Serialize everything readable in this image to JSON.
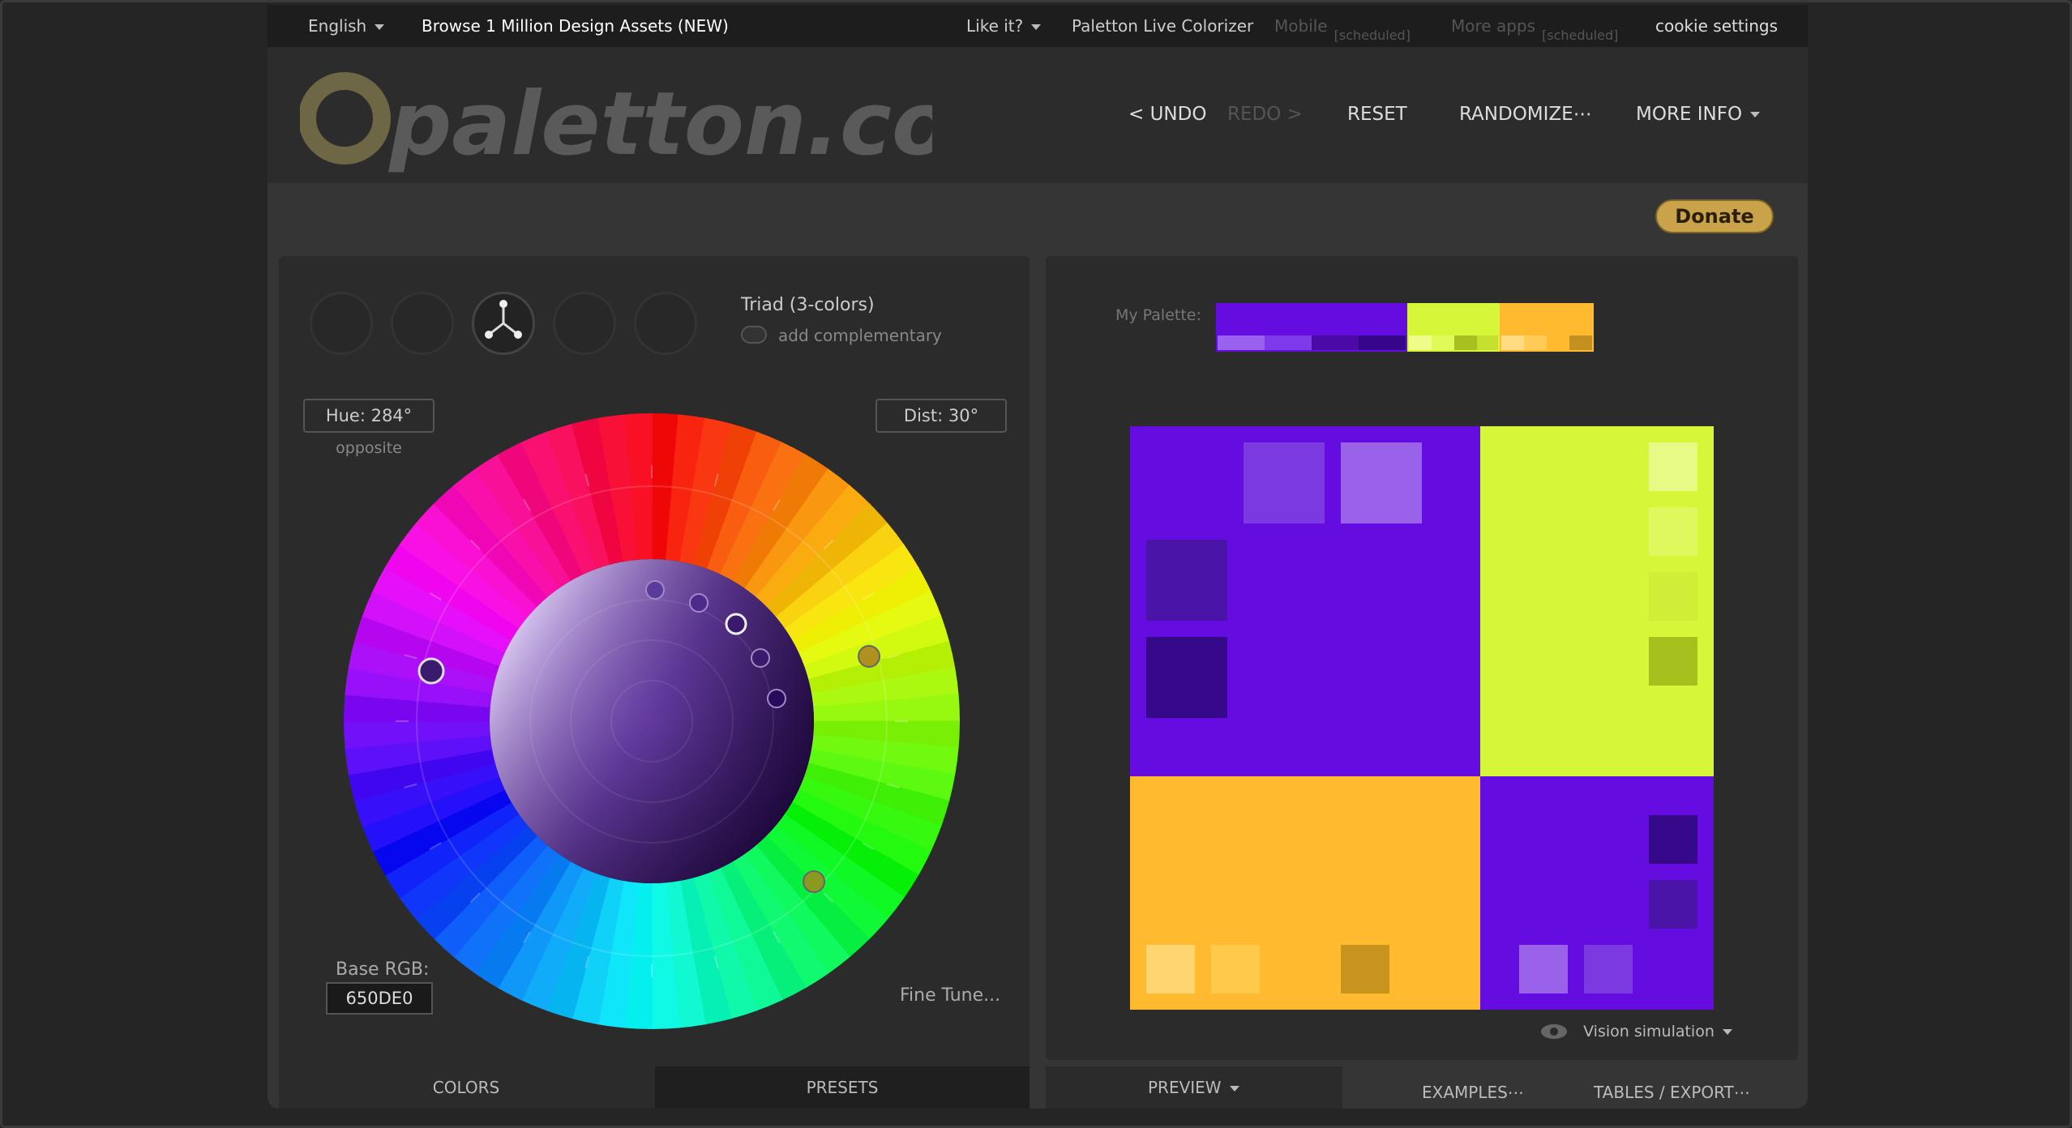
{
  "topbar": {
    "language": "English",
    "browse": "Browse 1 Million Design Assets (NEW)",
    "like": "Like it?",
    "live": "Paletton Live Colorizer",
    "mobile": "Mobile",
    "mobile_tag": "[scheduled]",
    "more_apps": "More apps",
    "more_apps_tag": "[scheduled]",
    "cookie": "cookie settings"
  },
  "header": {
    "logo_text": "paletton.com",
    "undo": "< UNDO",
    "redo": "REDO >",
    "reset": "RESET",
    "randomize": "RANDOMIZE⋯",
    "more_info": "MORE INFO"
  },
  "donate": "Donate",
  "left": {
    "scheme_title": "Triad (3-colors)",
    "add_complementary": "add complementary",
    "hue": "Hue: 284°",
    "opposite": "opposite",
    "dist": "Dist: 30°",
    "base_rgb_label": "Base RGB:",
    "base_rgb": "650DE0",
    "fine_tune": "Fine Tune...",
    "tab_colors": "COLORS",
    "tab_presets": "PRESETS"
  },
  "right": {
    "my_palette": "My Palette:",
    "vision": "Vision simulation",
    "tab_preview": "PREVIEW",
    "tab_examples": "EXAMPLES⋯",
    "tab_tables": "TABLES / EXPORT⋯"
  },
  "colors": {
    "primary": "#650DE0",
    "secondary": "#D6F63A",
    "tertiary": "#FFBA2F",
    "donate": "#C9A24A"
  }
}
